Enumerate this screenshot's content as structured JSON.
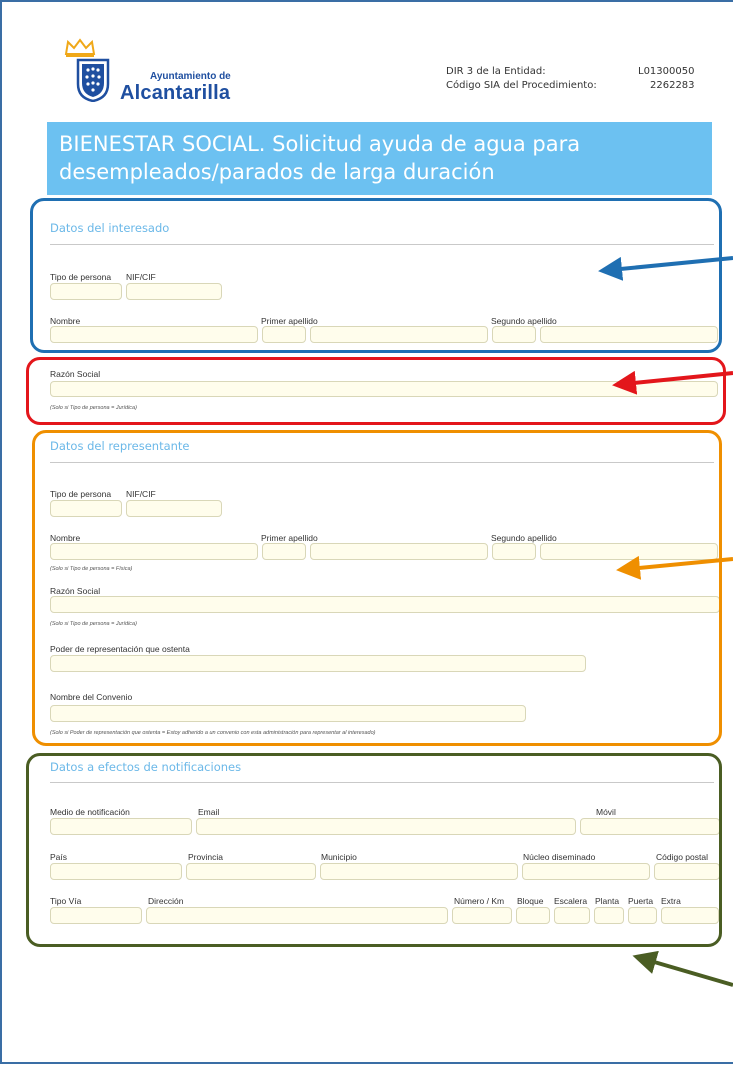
{
  "header": {
    "municipality_prefix": "Ayuntamiento de",
    "municipality_name": "Alcantarilla",
    "dir3_label": "DIR 3 de la Entidad:",
    "dir3_value": "L01300050",
    "sia_label": "Código SIA del Procedimiento:",
    "sia_value": "2262283"
  },
  "title": {
    "line1": "BIENESTAR SOCIAL. Solicitud ayuda de agua para",
    "line2": "desempleados/parados de larga duración"
  },
  "interesado": {
    "heading": "Datos del interesado",
    "tipo_persona": "Tipo de persona",
    "nif": "NIF/CIF",
    "nombre": "Nombre",
    "primer_apellido": "Primer apellido",
    "segundo_apellido": "Segundo apellido",
    "razon_social": "Razón Social",
    "razon_note": "(Solo si Tipo de persona = Jurídica)"
  },
  "representante": {
    "heading": "Datos del representante",
    "tipo_persona": "Tipo de persona",
    "nif": "NIF/CIF",
    "nombre": "Nombre",
    "primer_apellido": "Primer apellido",
    "segundo_apellido": "Segundo apellido",
    "fisica_note": "(Solo si Tipo de persona = Física)",
    "razon_social": "Razón Social",
    "razon_note": "(Solo si Tipo de persona = Jurídica)",
    "poder": "Poder de representación que ostenta",
    "convenio": "Nombre del Convenio",
    "convenio_note": "(Solo si Poder de representación que ostenta = Estoy adherido a un convenio con esta administración para representar al interesado)"
  },
  "notificaciones": {
    "heading": "Datos a efectos de notificaciones",
    "medio": "Medio de notificación",
    "email": "Email",
    "movil": "Móvil",
    "pais": "País",
    "provincia": "Provincia",
    "municipio": "Municipio",
    "nucleo": "Núcleo diseminado",
    "codigo_postal": "Código postal",
    "tipo_via": "Tipo Vía",
    "direccion": "Dirección",
    "numero": "Número / Km",
    "bloque": "Bloque",
    "escalera": "Escalera",
    "planta": "Planta",
    "puerta": "Puerta",
    "extra": "Extra"
  },
  "colors": {
    "interesado_box": "#1f6fb2",
    "razon_box": "#e3161b",
    "representante_box": "#ef8f00",
    "notificaciones_box": "#4a5d23",
    "title_band": "#6cc1f1",
    "section_heading": "#6bb8e8",
    "field_fill": "#fffdec"
  },
  "icons": [
    "crown-icon",
    "coat-of-arms-icon",
    "arrow-left-icon"
  ]
}
